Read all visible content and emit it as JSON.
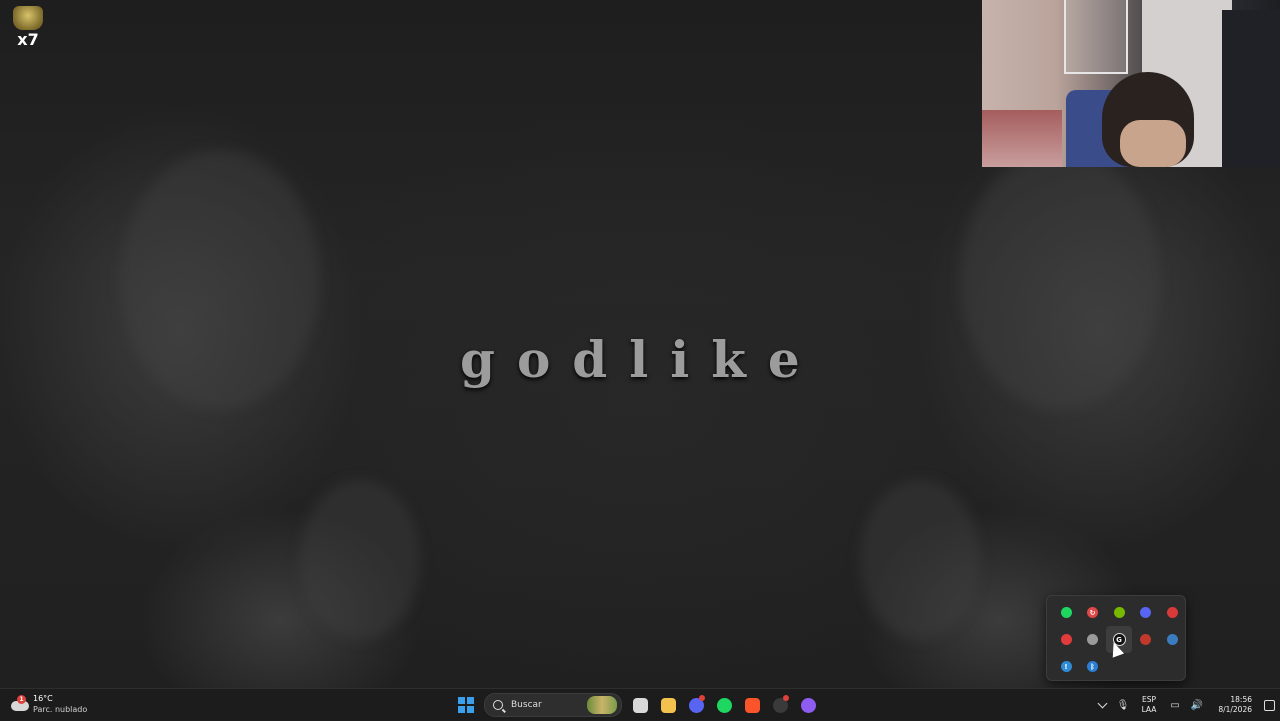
{
  "desktop": {
    "wallpaper_text": "godlike",
    "icon_label": "x7"
  },
  "tray_flyout": {
    "icons": [
      {
        "name": "spotify-icon",
        "color": "#1ed760",
        "glyph": ""
      },
      {
        "name": "sync-icon",
        "color": "#e04848",
        "glyph": "↻"
      },
      {
        "name": "nvidia-icon",
        "color": "#76b900",
        "glyph": ""
      },
      {
        "name": "discord-icon",
        "color": "#5865f2",
        "glyph": ""
      },
      {
        "name": "mic-icon",
        "color": "#d83a3a",
        "glyph": ""
      },
      {
        "name": "record-icon",
        "color": "#e23b3b",
        "glyph": ""
      },
      {
        "name": "globe-icon",
        "color": "#9a9a9a",
        "glyph": ""
      },
      {
        "name": "g-hub-icon",
        "color": "#111111",
        "glyph": "G"
      },
      {
        "name": "game-controller-icon",
        "color": "#c0392b",
        "glyph": ""
      },
      {
        "name": "steam-icon",
        "color": "#3b7bbf",
        "glyph": ""
      },
      {
        "name": "warning-app-icon",
        "color": "#2e8bd6",
        "glyph": "!"
      },
      {
        "name": "bluetooth-icon",
        "color": "#2a7fd4",
        "glyph": "ᛒ"
      }
    ]
  },
  "taskbar": {
    "weather": {
      "temp": "16°C",
      "condition": "Parc. nublado",
      "badge": "1"
    },
    "search": {
      "placeholder": "Buscar"
    },
    "apps": [
      {
        "name": "task-view-icon",
        "color": "#d8d8d8"
      },
      {
        "name": "file-explorer-icon",
        "color": "#f2c14e"
      },
      {
        "name": "discord-icon",
        "color": "#5865f2"
      },
      {
        "name": "spotify-icon",
        "color": "#1ed760"
      },
      {
        "name": "brave-icon",
        "color": "#fb542b"
      },
      {
        "name": "obs-icon",
        "color": "#3a3a3a"
      },
      {
        "name": "circle-app-icon",
        "color": "#8e5cf0"
      }
    ],
    "lang": {
      "line1": "ESP",
      "line2": "LAA"
    },
    "clock": {
      "time": "18:56",
      "date": "8/1/2026"
    }
  }
}
